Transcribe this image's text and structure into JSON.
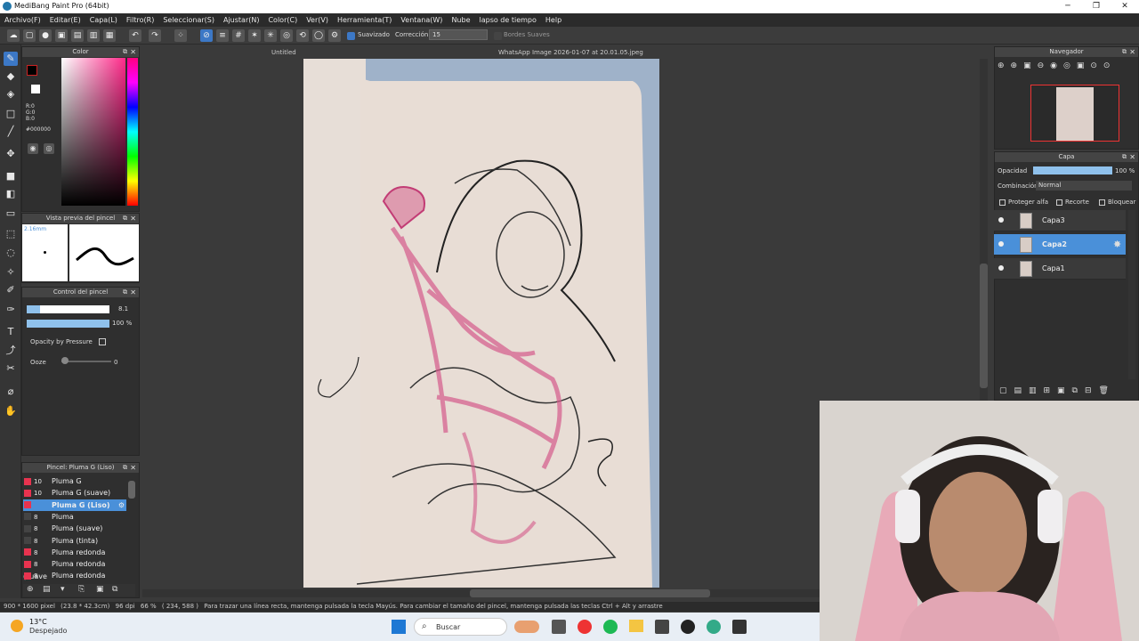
{
  "window": {
    "title": "MediBang Paint Pro (64bit)",
    "min": "─",
    "max": "❐",
    "close": "✕"
  },
  "menu": [
    "Archivo(F)",
    "Editar(E)",
    "Capa(L)",
    "Filtro(R)",
    "Seleccionar(S)",
    "Ajustar(N)",
    "Color(C)",
    "Ver(V)",
    "Herramienta(T)",
    "Ventana(W)",
    "Nube",
    "lapso de tiempo",
    "Help"
  ],
  "toolbar": {
    "smoothing_label": "Suavizado",
    "correction_label": "Corrección",
    "correction_value": "15",
    "soft_edges_label": "Bordes Suaves"
  },
  "color_panel": {
    "title": "Color",
    "r": "R:0",
    "g": "G:0",
    "b": "B:0",
    "hex": "#000000"
  },
  "brush_preview": {
    "title": "Vista previa del pincel",
    "size": "2.16mm"
  },
  "brush_control": {
    "title": "Control del pincel",
    "size_value": "8.1",
    "opacity_value": "100 %",
    "opacity_pressure_label": "Opacity by Pressure",
    "ooze_label": "Ooze",
    "ooze_value": "0"
  },
  "brush_list": {
    "title": "Pincel: Pluma G (Liso)",
    "items": [
      {
        "size": "10",
        "name": "Pluma G",
        "color": "red"
      },
      {
        "size": "10",
        "name": "Pluma G (suave)",
        "color": "red"
      },
      {
        "size": "",
        "name": "Pluma G (Liso)",
        "color": "red",
        "selected": true
      },
      {
        "size": "8",
        "name": "Pluma",
        "color": "dark"
      },
      {
        "size": "8",
        "name": "Pluma (suave)",
        "color": "dark"
      },
      {
        "size": "8",
        "name": "Pluma (tinta)",
        "color": "dark"
      },
      {
        "size": "8",
        "name": "Pluma redonda",
        "color": "red"
      },
      {
        "size": "8",
        "name": "Pluma redonda (suave",
        "color": "red"
      },
      {
        "size": "8",
        "name": "Pluma redonda (Liso)",
        "color": "red"
      }
    ]
  },
  "documents": {
    "tab1": "Untitled",
    "tab2": "WhatsApp Image 2026-01-07 at 20.01.05.jpeg"
  },
  "navigator": {
    "title": "Navegador"
  },
  "layers": {
    "title": "Capa",
    "opacity_label": "Opacidad",
    "opacity_value": "100 %",
    "opacity_fraction": 1.0,
    "blend_label": "Combinación",
    "blend_value": "Normal",
    "protect_alpha": "Proteger alfa",
    "clip": "Recorte",
    "lock": "Bloquear",
    "items": [
      {
        "name": "Capa3",
        "selected": false
      },
      {
        "name": "Capa2",
        "selected": true
      },
      {
        "name": "Capa1",
        "selected": false
      }
    ]
  },
  "status": {
    "size": "900 * 1600 pixel",
    "physical": "(23.8 * 42.3cm)",
    "dpi": "96 dpi",
    "zoom": "66 %",
    "coords": "( 234, 588 )",
    "hint": "Para trazar una línea recta, mantenga pulsada la tecla Mayús. Para cambiar el tamaño del pincel, mantenga pulsada las teclas Ctrl + Alt y arrastre"
  },
  "taskbar": {
    "weather_temp": "13°C",
    "weather_desc": "Despejado",
    "search_placeholder": "Buscar"
  },
  "colors": {
    "accent": "#4a90d9",
    "brush_red": "#e8334f",
    "sketch_pink": "#d45a8a"
  }
}
